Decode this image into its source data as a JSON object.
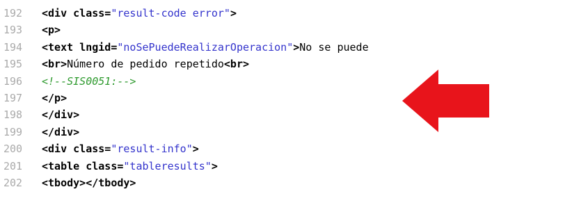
{
  "editor": {
    "lines": [
      {
        "number": "192",
        "tokens": [
          {
            "type": "tag",
            "text": "<div "
          },
          {
            "type": "attr",
            "text": "class="
          },
          {
            "type": "str",
            "text": "\"result-code error\""
          },
          {
            "type": "tag",
            "text": ">"
          }
        ]
      },
      {
        "number": "193",
        "tokens": [
          {
            "type": "tag",
            "text": "<p>"
          }
        ]
      },
      {
        "number": "194",
        "tokens": [
          {
            "type": "tag",
            "text": "<text "
          },
          {
            "type": "attr",
            "text": "lngid="
          },
          {
            "type": "str",
            "text": "\"noSePuedeRealizarOperacion\""
          },
          {
            "type": "tag",
            "text": ">"
          },
          {
            "type": "text",
            "text": "No se puede"
          }
        ]
      },
      {
        "number": "195",
        "tokens": [
          {
            "type": "tag",
            "text": "<br>"
          },
          {
            "type": "text",
            "text": "Número de pedido repetido"
          },
          {
            "type": "tag",
            "text": "<br>"
          }
        ]
      },
      {
        "number": "196",
        "tokens": [
          {
            "type": "comment",
            "text": "<!--SIS0051:-->"
          }
        ]
      },
      {
        "number": "197",
        "tokens": [
          {
            "type": "tag",
            "text": "</p>"
          }
        ]
      },
      {
        "number": "198",
        "tokens": [
          {
            "type": "tag",
            "text": "</div>"
          }
        ]
      },
      {
        "number": "199",
        "tokens": [
          {
            "type": "tag",
            "text": "</div>"
          }
        ]
      },
      {
        "number": "200",
        "tokens": [
          {
            "type": "tag",
            "text": "<div "
          },
          {
            "type": "attr",
            "text": "class="
          },
          {
            "type": "str",
            "text": "\"result-info\""
          },
          {
            "type": "tag",
            "text": ">"
          }
        ]
      },
      {
        "number": "201",
        "tokens": [
          {
            "type": "tag",
            "text": "<table "
          },
          {
            "type": "attr",
            "text": "class="
          },
          {
            "type": "str",
            "text": "\"tableresults\""
          },
          {
            "type": "tag",
            "text": ">"
          }
        ]
      },
      {
        "number": "202",
        "tokens": [
          {
            "type": "tag",
            "text": "<tbody></tbody>"
          }
        ]
      }
    ]
  },
  "annotation": {
    "icon": "left-arrow-icon",
    "color": "#e8141b"
  },
  "colors": {
    "line_number": "#aaaaaa",
    "string": "#3333cc",
    "comment": "#2e9a2e",
    "tag": "#000000"
  }
}
